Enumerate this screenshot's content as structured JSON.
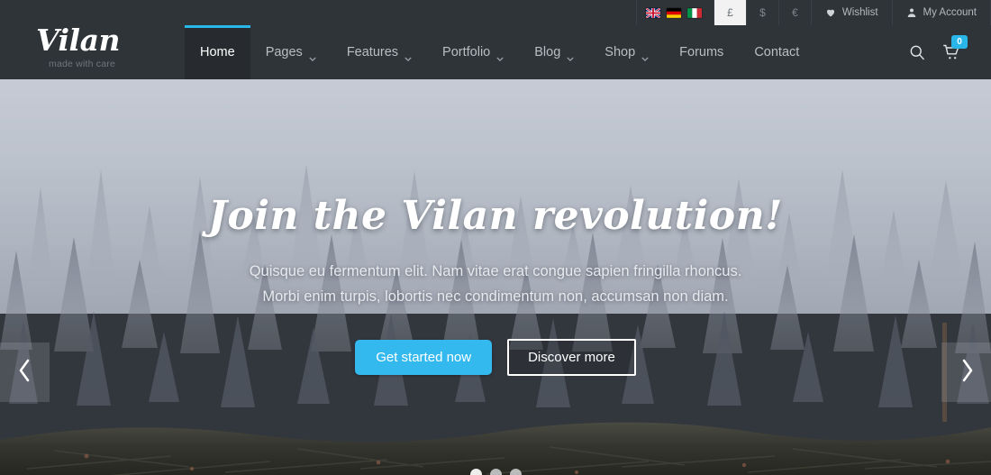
{
  "topbar": {
    "languages": [
      {
        "name": "english-flag",
        "label": "English"
      },
      {
        "name": "german-flag",
        "label": "Deutsch"
      },
      {
        "name": "italian-flag",
        "label": "Italiano"
      }
    ],
    "currencies": [
      {
        "symbol": "£",
        "active": true
      },
      {
        "symbol": "$",
        "active": false
      },
      {
        "symbol": "€",
        "active": false
      }
    ],
    "wishlist_label": "Wishlist",
    "wishlist_icon": "heart-icon",
    "account_label": "My Account",
    "account_icon": "user-icon"
  },
  "header": {
    "logo_text": "Vilan",
    "logo_tagline": "made with care",
    "nav": [
      {
        "label": "Home",
        "has_caret": false,
        "active": true
      },
      {
        "label": "Pages",
        "has_caret": true,
        "active": false
      },
      {
        "label": "Features",
        "has_caret": true,
        "active": false
      },
      {
        "label": "Portfolio",
        "has_caret": true,
        "active": false
      },
      {
        "label": "Blog",
        "has_caret": true,
        "active": false
      },
      {
        "label": "Shop",
        "has_caret": true,
        "active": false
      },
      {
        "label": "Forums",
        "has_caret": false,
        "active": false
      },
      {
        "label": "Contact",
        "has_caret": false,
        "active": false
      }
    ],
    "search_icon": "search-icon",
    "cart_icon": "shopping-cart-icon",
    "cart_count": "0"
  },
  "hero": {
    "title": "Join the Vilan revolution!",
    "subtitle_line1": "Quisque eu fermentum elit. Nam vitae erat congue sapien fringilla rhoncus.",
    "subtitle_line2": "Morbi enim turpis, lobortis nec condimentum non, accumsan non diam.",
    "primary_button": "Get started now",
    "secondary_button": "Discover more",
    "prev_arrow": "chevron-left-icon",
    "next_arrow": "chevron-right-icon",
    "slide_count": 3,
    "active_slide": 1,
    "background_description": "Misty foggy pine forest landscape"
  },
  "colors": {
    "accent": "#29b6e8",
    "header_bg": "#2f3439",
    "nav_active_bg": "#272b2f",
    "text_muted": "#a2a8ad"
  }
}
